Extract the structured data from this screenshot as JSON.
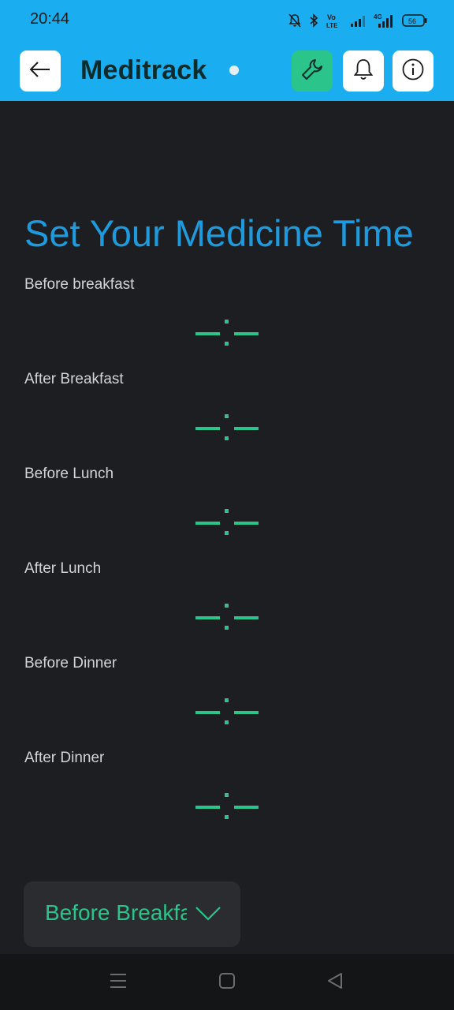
{
  "status_bar": {
    "time": "20:44",
    "battery": "56"
  },
  "header": {
    "title": "Meditrack",
    "icons": [
      "arrow-left-icon",
      "wrench-icon",
      "bell-icon",
      "info-icon"
    ]
  },
  "main": {
    "title": "Set Your Medicine Time",
    "slots": [
      {
        "label": "Before breakfast",
        "time": "–:–"
      },
      {
        "label": "After Breakfast",
        "time": "–:–"
      },
      {
        "label": "Before Lunch",
        "time": "–:–"
      },
      {
        "label": "After Lunch",
        "time": "–:–"
      },
      {
        "label": "Before Dinner",
        "time": "–:–"
      },
      {
        "label": "After Dinner",
        "time": "–:–"
      }
    ],
    "dropdown": {
      "value": "Before Breakfast"
    }
  },
  "colors": {
    "header_bg": "#1aaef0",
    "accent_green": "#2bc48a",
    "title_blue": "#1e9bde",
    "background": "#1d1e21"
  }
}
